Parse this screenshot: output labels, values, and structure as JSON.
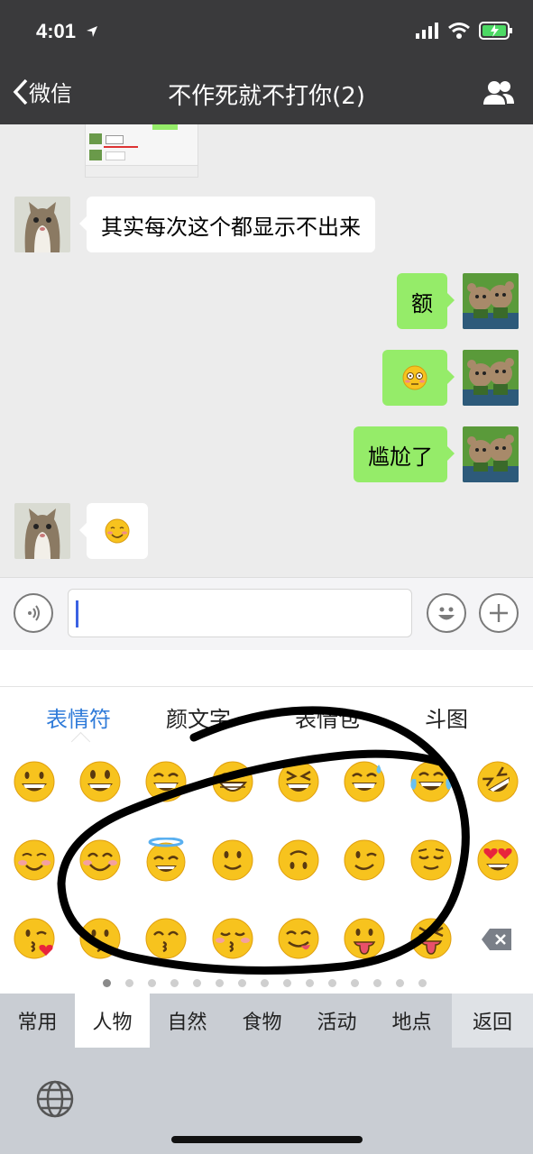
{
  "status": {
    "time": "4:01"
  },
  "nav": {
    "back_label": "微信",
    "title": "不作死就不打你(2)"
  },
  "messages": [
    {
      "side": "left",
      "text": "其实每次这个都显示不出来"
    },
    {
      "side": "right",
      "text": "额"
    },
    {
      "side": "right",
      "emoji": "flushed-face"
    },
    {
      "side": "right",
      "text": "尴尬了"
    },
    {
      "side": "left",
      "emoji": "smiling-face"
    }
  ],
  "keyboard_tabs": [
    "表情符",
    "颜文字",
    "表情包",
    "斗图"
  ],
  "active_tab": "表情符",
  "categories": [
    "常用",
    "人物",
    "自然",
    "食物",
    "活动",
    "地点",
    "返回"
  ],
  "active_category": "人物",
  "page_dots": {
    "count": 15,
    "active": 1
  },
  "colors": {
    "bar_dark": "#3a3a3c",
    "bubble_green": "#95ec69",
    "accent_blue": "#2f7bd9",
    "emoji_yellow": "#f7c31e"
  }
}
